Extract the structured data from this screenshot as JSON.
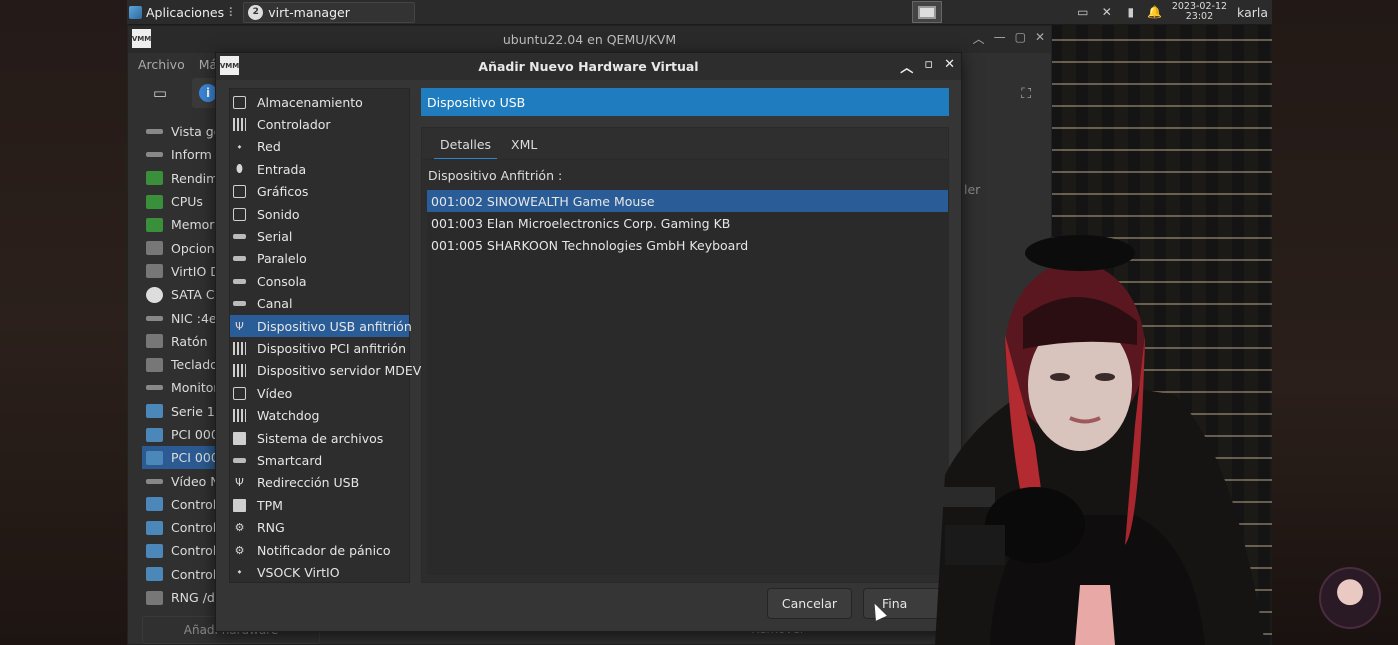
{
  "taskbar": {
    "apps_label": "Aplicaciones",
    "task_label": "virt-manager",
    "task_badge": "2",
    "clock_date": "2023-02-12",
    "clock_time": "23:02",
    "user": "karla"
  },
  "main_window": {
    "title": "ubuntu22.04 en QEMU/KVM",
    "menu": [
      "Archivo",
      "Má"
    ],
    "side_text": "ler",
    "add_hw_label": "Añadi hardware",
    "remove_label": "Remover",
    "hardware_items": [
      {
        "label": "Vista ge"
      },
      {
        "label": "Inform"
      },
      {
        "label": "Rendim"
      },
      {
        "label": "CPUs"
      },
      {
        "label": "Memor"
      },
      {
        "label": "Opcione"
      },
      {
        "label": "VirtIO D"
      },
      {
        "label": "SATA CI"
      },
      {
        "label": "NIC :4e"
      },
      {
        "label": "Ratón"
      },
      {
        "label": "Teclado"
      },
      {
        "label": "Monitor"
      },
      {
        "label": "Serie 1"
      },
      {
        "label": "PCI 000"
      },
      {
        "label": "PCI 000"
      },
      {
        "label": "Vídeo N"
      },
      {
        "label": "Control"
      },
      {
        "label": "Control"
      },
      {
        "label": "Control"
      },
      {
        "label": "Control"
      },
      {
        "label": "RNG /de"
      }
    ]
  },
  "dialog": {
    "title": "Añadir Nuevo Hardware Virtual",
    "categories": [
      "Almacenamiento",
      "Controlador",
      "Red",
      "Entrada",
      "Gráficos",
      "Sonido",
      "Serial",
      "Paralelo",
      "Consola",
      "Canal",
      "Dispositivo USB anfitrión",
      "Dispositivo PCI anfitrión",
      "Dispositivo servidor MDEV",
      "Vídeo",
      "Watchdog",
      "Sistema de archivos",
      "Smartcard",
      "Redirección USB",
      "TPM",
      "RNG",
      "Notificador de pánico",
      "VSOCK VirtIO"
    ],
    "selected_category_index": 10,
    "header": "Dispositivo USB",
    "tabs": [
      "Detalles",
      "XML"
    ],
    "host_device_label": "Dispositivo Anfitrión :",
    "devices": [
      "001:002 SINOWEALTH Game Mouse",
      "001:003 Elan Microelectronics Corp. Gaming KB",
      "001:005 SHARKOON Technologies GmbH Keyboard"
    ],
    "selected_device_index": 0,
    "cancel_label": "Cancelar",
    "finish_label": "Fina"
  }
}
